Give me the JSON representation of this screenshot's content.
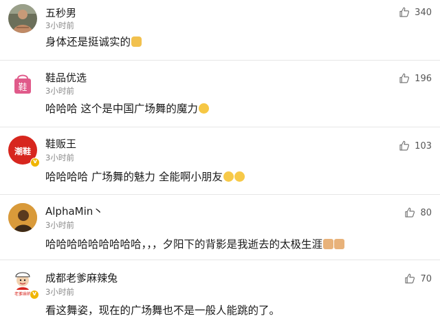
{
  "comments": [
    {
      "username": "五秒男",
      "time": "3小时前",
      "content": "身体还是挺诚实的",
      "emojis": [
        "smirk-face-emoji"
      ],
      "likes": "340",
      "verified": false,
      "avatar": "photo-avatar"
    },
    {
      "username": "鞋品优选",
      "time": "3小时前",
      "content": "哈哈哈 这个是中国广场舞的魔力",
      "emojis": [
        "laugh-cry-emoji"
      ],
      "likes": "196",
      "verified": false,
      "avatar": "shopping-bag-logo",
      "avatar_text": "鞋"
    },
    {
      "username": "鞋贩王",
      "time": "3小时前",
      "content": "哈哈哈哈 广场舞的魅力 全能啊小朋友",
      "emojis": [
        "laugh-emoji",
        "laugh-emoji"
      ],
      "likes": "103",
      "verified": true,
      "avatar": "red-badge-logo",
      "avatar_text": "潮鞋"
    },
    {
      "username": "AlphaMin丶",
      "time": "3小时前",
      "content": "哈哈哈哈哈哈哈哈哈，，，夕阳下的背影是我逝去的太极生涯",
      "emojis": [
        "cat-emoji",
        "cat-emoji"
      ],
      "likes": "80",
      "verified": false,
      "avatar": "photo-avatar"
    },
    {
      "username": "成都老爹麻辣兔",
      "time": "3小时前",
      "content": "看这舞姿，现在的广场舞也不是一般人能跳的了。",
      "emojis": [],
      "likes": "70",
      "verified": true,
      "avatar": "cartoon-chef-logo",
      "avatar_text": "老爹麻辣"
    }
  ],
  "colors": {
    "verified_badge": "#f0b500",
    "divider": "#e6e6e6",
    "brand_red": "#d7261e",
    "bag_pink": "#e05a8a"
  }
}
